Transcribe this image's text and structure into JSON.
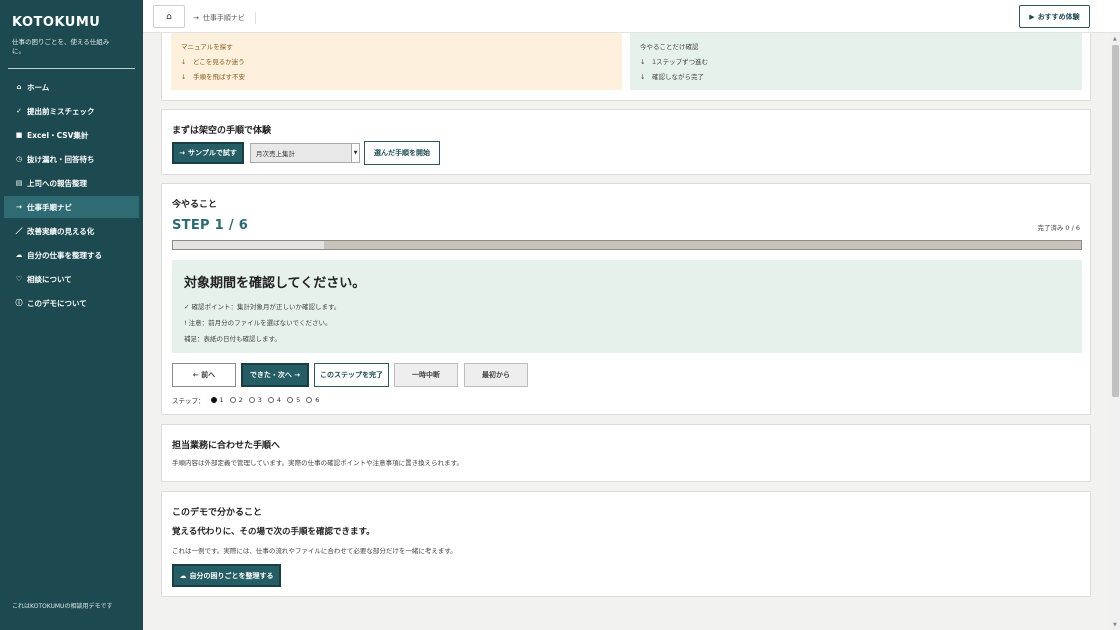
{
  "app": {
    "brand": "KOTOKUMU",
    "tagline": "仕事の困りごとを、使える仕組みに。",
    "footer": "これはKOTOKUMUの相談用デモです"
  },
  "sidebar": {
    "items": [
      {
        "icon": "⌂",
        "label": "ホーム",
        "active": false
      },
      {
        "icon": "✓",
        "label": "提出前ミスチェック",
        "active": false
      },
      {
        "icon": "■",
        "label": "Excel・CSV集計",
        "active": false
      },
      {
        "icon": "◷",
        "label": "抜け漏れ・回答待ち",
        "active": false
      },
      {
        "icon": "▤",
        "label": "上司への報告整理",
        "active": false
      },
      {
        "icon": "→",
        "label": "仕事手順ナビ",
        "active": true
      },
      {
        "icon": "／",
        "label": "改善実績の見える化",
        "active": false
      },
      {
        "icon": "☁",
        "label": "自分の仕事を整理する",
        "active": false
      },
      {
        "icon": "♡",
        "label": "相談について",
        "active": false
      },
      {
        "icon": "ⓘ",
        "label": "このデモについて",
        "active": false
      }
    ]
  },
  "topbar": {
    "home_icon": "⌂",
    "breadcrumb_arrow": "→",
    "breadcrumb": "仕事手順ナビ",
    "recommend_icon": "▶",
    "recommend_label": "おすすめ体験"
  },
  "tips": {
    "left": {
      "title": "マニュアルを探す",
      "lines": [
        "どこを見るか迷う",
        "手順を飛ばす不安"
      ]
    },
    "right": {
      "title": "今やることだけ確認",
      "lines": [
        "1ステップずつ進む",
        "確認しながら完了"
      ]
    },
    "arrow": "↓"
  },
  "sample": {
    "title": "まずは架空の手順で体験",
    "try_label": "サンプルで試す",
    "try_icon": "→",
    "select_value": "月次売上集計",
    "start_label": "選んだ手順を開始"
  },
  "now": {
    "title": "今やること",
    "step_label": "STEP 1 / 6",
    "done_label": "完了済み 0 / 6",
    "progress_fraction": 0.166,
    "instruction_heading": "対象期間を確認してください。",
    "check_line": "✓ 確認ポイント：集計対象月が正しいか確認します。",
    "warn_line": "! 注意：前月分のファイルを選ばないでください。",
    "note_line": "補足：表紙の日付も確認します。",
    "prev_label": "← 前へ",
    "next_label": "できた・次へ →",
    "complete_label": "このステップを完了",
    "pause_label": "一時中断",
    "restart_label": "最初から",
    "steps_prefix": "ステップ：",
    "steps": [
      "1",
      "2",
      "3",
      "4",
      "5",
      "6"
    ],
    "current_step": 1
  },
  "duty": {
    "title": "担当業務に合わせた手順へ",
    "text": "手順内容は外部定義で管理しています。実際の仕事の確認ポイントや注意事項に置き換えられます。"
  },
  "demo": {
    "title": "このデモで分かること",
    "subtitle": "覚える代わりに、その場で次の手順を確認できます。",
    "text": "これは一例です。実際には、仕事の流れやファイルに合わせて必要な部分だけを一緒に考えます。",
    "button_icon": "☁",
    "button_label": "自分の困りごとを整理する"
  }
}
